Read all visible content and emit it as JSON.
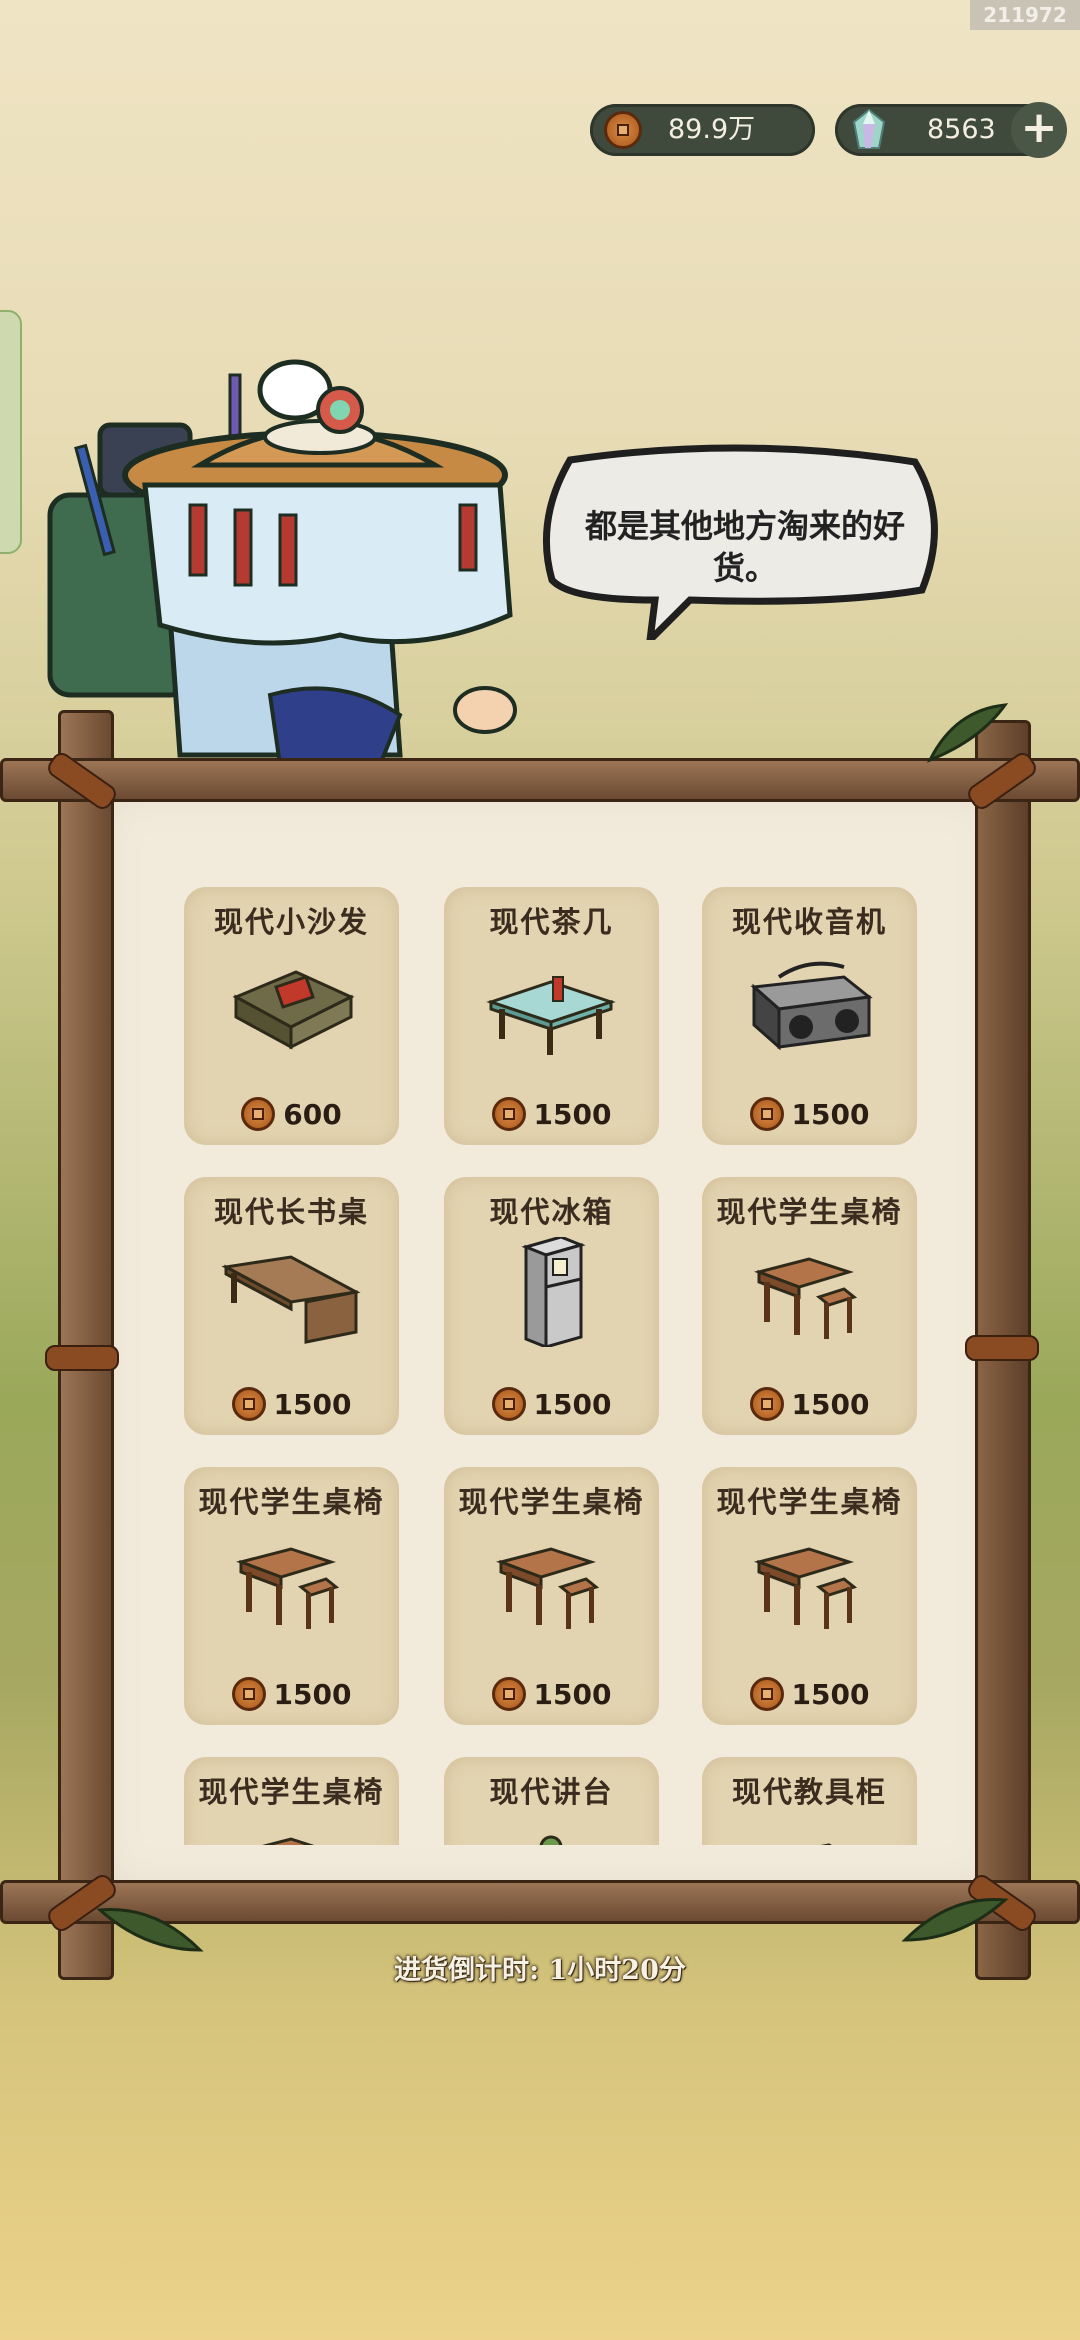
{
  "watermark": "211972",
  "currency": {
    "coins": "89.9万",
    "gems": "8563"
  },
  "merchant": {
    "speech": "都是其他地方淘来的好货。"
  },
  "shop": {
    "items": [
      {
        "name": "现代小沙发",
        "price": "600",
        "icon": "sofa-icon"
      },
      {
        "name": "现代茶几",
        "price": "1500",
        "icon": "tea-table-icon"
      },
      {
        "name": "现代收音机",
        "price": "1500",
        "icon": "radio-icon"
      },
      {
        "name": "现代长书桌",
        "price": "1500",
        "icon": "long-desk-icon"
      },
      {
        "name": "现代冰箱",
        "price": "1500",
        "icon": "fridge-icon"
      },
      {
        "name": "现代学生桌椅",
        "price": "1500",
        "icon": "student-desk-icon"
      },
      {
        "name": "现代学生桌椅",
        "price": "1500",
        "icon": "student-desk-icon"
      },
      {
        "name": "现代学生桌椅",
        "price": "1500",
        "icon": "student-desk-icon"
      },
      {
        "name": "现代学生桌椅",
        "price": "1500",
        "icon": "student-desk-icon"
      },
      {
        "name": "现代学生桌椅",
        "price": "",
        "icon": "student-desk-icon"
      },
      {
        "name": "现代讲台",
        "price": "",
        "icon": "podium-icon"
      },
      {
        "name": "现代教具柜",
        "price": "",
        "icon": "cabinet-icon"
      }
    ]
  },
  "countdown": "进货倒计时: 1小时20分"
}
